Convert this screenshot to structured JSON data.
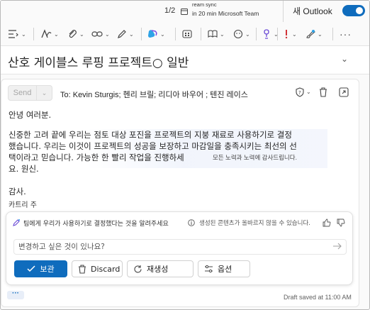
{
  "topbar": {
    "pager": "1/2",
    "meeting_title": "ream sync",
    "meeting_sub": "in 20 min Microsoft Teams Mee...",
    "outlook_label": "새 Outlook"
  },
  "subject": {
    "text": "산호 게이블스 루핑 프로젝트○ 일반"
  },
  "compose": {
    "send_label": "Send",
    "to_line": "To: Kevin Sturgis; 헨리 브릴; 리디아 바우어 ; 텐진 레이스",
    "greeting": "안녕 여러분.",
    "body_line1": "신중한 고려 끝에 우리는 점토 대상 포진을 프로젝트의 지붕 재료로 사용하기로 결정",
    "body_line2": "했습니다. 우리는 이것이 프로젝트의 성공을 보장하고 마감일을 충족시키는 최선의 선",
    "body_line3": "택이라고 믿습니다. 가능한 한 빨리 작업을 진행하세",
    "body_line4": "요. 원신.",
    "side_hint": "모든 노력과 노력에 감사드립니다.",
    "thanks": "감사.",
    "signature": "카트리 주",
    "draft_status": "Draft saved at 11:00 AM",
    "more_dots": "···"
  },
  "copilot": {
    "summary": "팀에게 우리가 사용하기로 결정했다는 것을 알려주세요",
    "note": "생성된 콘텐츠가 올바르지 않을 수 있습니다.",
    "input_placeholder": "변경하고 싶은 것이 있나요?",
    "keep_label": "보관",
    "discard_label": "Discard",
    "regenerate_label": "재생성",
    "options_label": "옵션"
  },
  "colors": {
    "accent": "#0f6cbd",
    "copilot_highlight": "#eef1fb"
  }
}
